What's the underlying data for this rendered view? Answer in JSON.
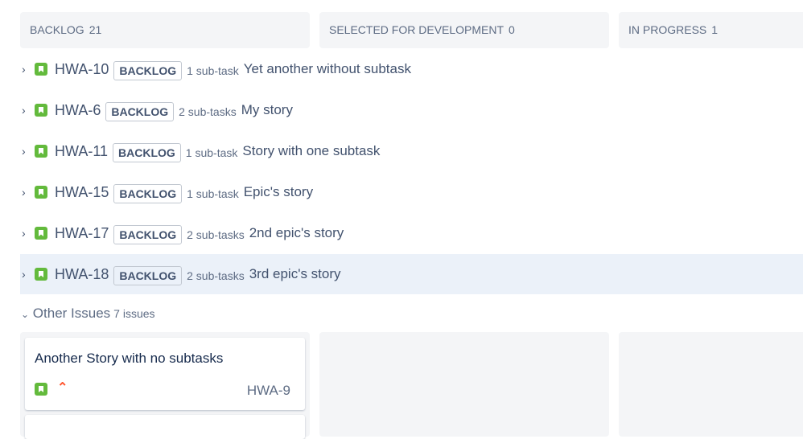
{
  "columns": [
    {
      "name": "BACKLOG",
      "count": "21"
    },
    {
      "name": "SELECTED FOR DEVELOPMENT",
      "count": "0"
    },
    {
      "name": "IN PROGRESS",
      "count": "1"
    }
  ],
  "rows": [
    {
      "key": "HWA-10",
      "status": "BACKLOG",
      "subtasks": "1 sub-task",
      "summary": "Yet another without subtask"
    },
    {
      "key": "HWA-6",
      "status": "BACKLOG",
      "subtasks": "2 sub-tasks",
      "summary": "My story"
    },
    {
      "key": "HWA-11",
      "status": "BACKLOG",
      "subtasks": "1 sub-task",
      "summary": "Story with one subtask"
    },
    {
      "key": "HWA-15",
      "status": "BACKLOG",
      "subtasks": "1 sub-task",
      "summary": "Epic's story"
    },
    {
      "key": "HWA-17",
      "status": "BACKLOG",
      "subtasks": "2 sub-tasks",
      "summary": "2nd epic's story"
    },
    {
      "key": "HWA-18",
      "status": "BACKLOG",
      "subtasks": "2 sub-tasks",
      "summary": "3rd epic's story"
    }
  ],
  "other": {
    "label": "Other Issues",
    "count": "7 issues"
  },
  "card": {
    "title": "Another Story with no subtasks",
    "key": "HWA-9"
  }
}
